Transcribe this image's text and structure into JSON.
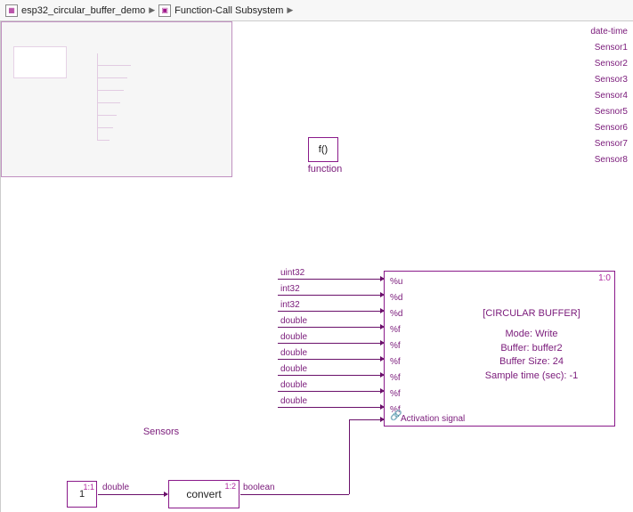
{
  "breadcrumb": {
    "model_name": "esp32_circular_buffer_demo",
    "subsystem": "Function-Call Subsystem"
  },
  "function_block": {
    "text": "f()",
    "label": "function"
  },
  "sensors": {
    "title": "Sensors",
    "ports": [
      "date-time",
      "Sensor1",
      "Sensor2",
      "Sensor3",
      "Sensor4",
      "Sesnor5",
      "Sensor6",
      "Sensor7",
      "Sensor8"
    ]
  },
  "types": [
    "uint32",
    "int32",
    "int32",
    "double",
    "double",
    "double",
    "double",
    "double",
    "double"
  ],
  "cbuf": {
    "badge": "1:0",
    "ports": [
      "%u",
      "%d",
      "%d",
      "%f",
      "%f",
      "%f",
      "%f",
      "%f",
      "%f",
      "Activation signal"
    ],
    "title": "[CIRCULAR BUFFER]",
    "lines": [
      "Mode: Write",
      "Buffer: buffer2",
      "Buffer Size: 24",
      "Sample time (sec): -1"
    ]
  },
  "constant": {
    "value": "1",
    "badge": "1:1",
    "type": "double"
  },
  "convert": {
    "label": "convert",
    "badge": "1:2",
    "out_type": "boolean"
  }
}
